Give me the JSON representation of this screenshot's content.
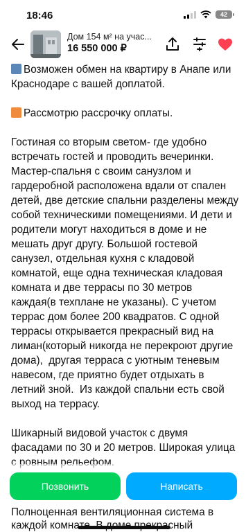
{
  "status_bar": {
    "time": "18:46",
    "battery": "42"
  },
  "header": {
    "title": "Дом 154 м² на учас...",
    "price": "16 550 000 ₽"
  },
  "icons": {
    "back": "back-arrow-icon",
    "share": "share-icon",
    "compare": "compare-icon",
    "favorite": "heart-icon",
    "favorite_color": "#ff4053"
  },
  "description": {
    "p1": "Возможен обмен на квартиру в Анапе или Краснодаре с вашей доплатой.",
    "p2": "Рассмотрю рассрочку оплаты.",
    "p3": "Гостиная со вторым светом- где удобно встречать гостей и проводить вечеринки. Мастер-спальня с своим санузлом и гардеробной расположена вдали от спален детей, две детские спальни разделены между собой техническими помещениями. И дети и родители могут находиться в доме и не мешать друг другу. Большой гостевой санузел, отдельная кухня с кладовой комнатой, еще одна техническая кладовая комната и две террасы по 30 метров каждая(в техплане не указаны). С учетом террас дом более 200 квадратов. С одной террасы открывается прекрасный вид на лиман(который никогда не перекроют другие дома),  другая терраса с уютным теневым навесом, где приятно будет отдыхать в летний зной.  Из каждой спальни есть свой выход на террасу.",
    "p4": "Шикарный видовой участок с двумя фасадами по 30 и 20 метров. Широкая улица с ровным рельефом.",
    "tail": "Полноценная вентиляционная система в каждой комнате. В доме прекрасный"
  },
  "actions": {
    "call_label": "Позвонить",
    "write_label": "Написать",
    "call_color": "#02d15c",
    "write_color": "#00aaff"
  }
}
